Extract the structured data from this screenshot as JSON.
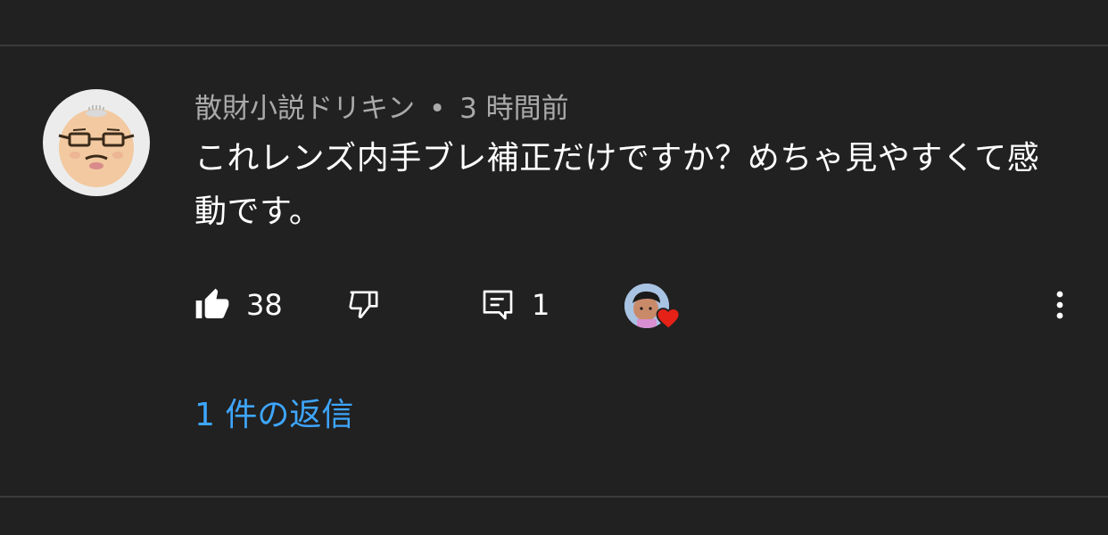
{
  "comment": {
    "author": "散財小説ドリキン",
    "separator": "•",
    "timestamp": "3 時間前",
    "text": "これレンズ内手ブレ補正だけですか？めちゃ見やすくて感動です。",
    "like_count": "38",
    "reply_count": "1",
    "replies_link": "1 件の返信"
  },
  "icons": {
    "like": "thumbs-up-filled-icon",
    "dislike": "thumbs-down-outline-icon",
    "reply": "comment-icon",
    "hearted": "creator-heart-icon",
    "more": "more-vertical-icon"
  },
  "colors": {
    "background": "#212121",
    "divider": "#3a3a3a",
    "meta_text": "#aaaaaa",
    "body_text": "#ffffff",
    "link": "#3ea6ff",
    "heart": "#e62117"
  }
}
